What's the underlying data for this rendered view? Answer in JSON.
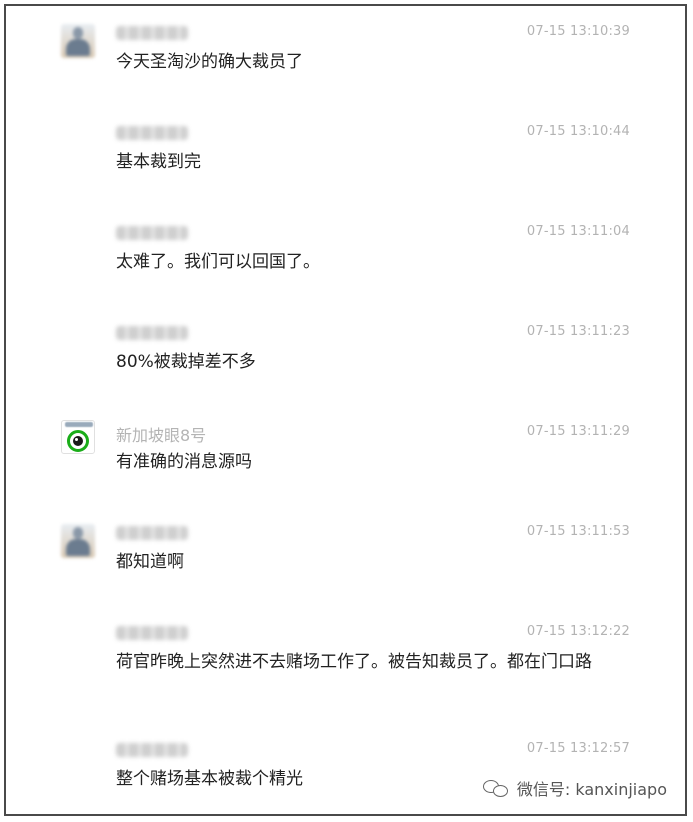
{
  "messages": [
    {
      "name": "",
      "name_visible": false,
      "avatar": "user",
      "time": "07-15 13:10:39",
      "text": "今天圣淘沙的确大裁员了"
    },
    {
      "name": "",
      "name_visible": false,
      "avatar": "none",
      "time": "07-15 13:10:44",
      "text": "基本裁到完"
    },
    {
      "name": "",
      "name_visible": false,
      "avatar": "none",
      "time": "07-15 13:11:04",
      "text": "太难了。我们可以回国了。"
    },
    {
      "name": "",
      "name_visible": false,
      "avatar": "none",
      "time": "07-15 13:11:23",
      "text": "80%被裁掉差不多"
    },
    {
      "name": "新加坡眼8号",
      "name_visible": true,
      "avatar": "brand",
      "time": "07-15 13:11:29",
      "text": "有准确的消息源吗"
    },
    {
      "name": "",
      "name_visible": false,
      "avatar": "user",
      "time": "07-15 13:11:53",
      "text": "都知道啊"
    },
    {
      "name": "",
      "name_visible": false,
      "avatar": "none",
      "time": "07-15 13:12:22",
      "text": "荷官昨晚上突然进不去赌场工作了。被告知裁员了。都在门口路"
    },
    {
      "name": "",
      "name_visible": false,
      "avatar": "none",
      "time": "07-15 13:12:57",
      "text": "整个赌场基本被裁个精光"
    }
  ],
  "watermark": {
    "icon": "wechat-icon",
    "text": "微信号: kanxinjiapo"
  },
  "colors": {
    "time": "#b3b3b3",
    "text": "#222222",
    "brand_green": "#1aad19"
  }
}
